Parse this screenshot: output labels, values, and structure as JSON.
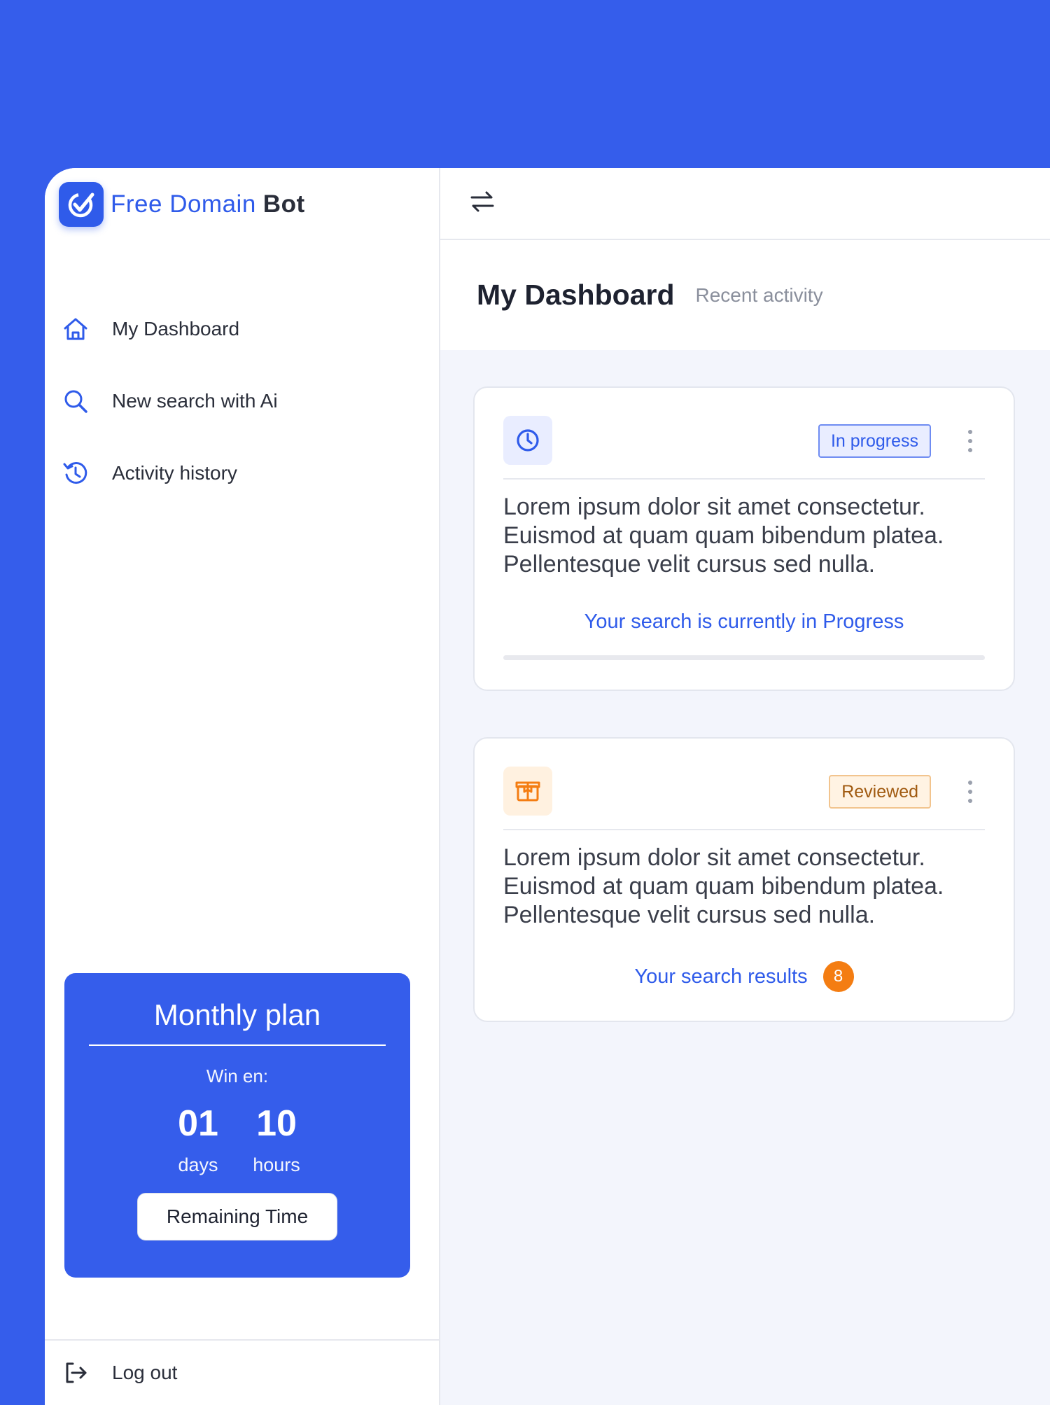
{
  "brand": {
    "name_part1": "Free Domain",
    "name_part2": "Bot"
  },
  "sidebar": {
    "items": [
      {
        "label": "My Dashboard",
        "icon": "home-icon"
      },
      {
        "label": "New search with Ai",
        "icon": "search-icon"
      },
      {
        "label": "Activity history",
        "icon": "history-icon"
      }
    ],
    "plan": {
      "title": "Monthly plan",
      "subtitle": "Win en:",
      "days_value": "01",
      "days_label": "days",
      "hours_value": "10",
      "hours_label": "hours",
      "button_label": "Remaining Time"
    },
    "logout_label": "Log out"
  },
  "header": {
    "title": "My Dashboard",
    "subtitle": "Recent activity"
  },
  "cards": [
    {
      "status": "In progress",
      "icon": "clock-icon",
      "body": "Lorem ipsum dolor sit amet consectetur. Euismod at quam quam bibendum platea. Pellentesque velit cursus sed nulla.",
      "link": "Your search is currently in Progress",
      "progress": 0
    },
    {
      "status": "Reviewed",
      "icon": "box-icon",
      "body": "Lorem ipsum dolor sit amet consectetur. Euismod at quam quam bibendum platea. Pellentesque velit cursus sed nulla.",
      "link": "Your search results",
      "count": "8"
    }
  ],
  "colors": {
    "accent": "#355DEB",
    "link": "#2F5BEA",
    "badge_orange": "#F47D12",
    "background": "#F3F5FC"
  }
}
